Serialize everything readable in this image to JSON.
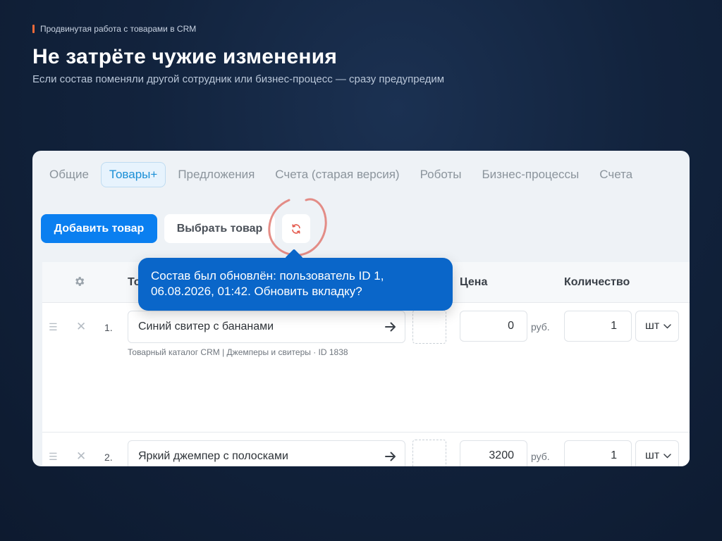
{
  "header": {
    "eyebrow": "Продвинутая работа с товарами в CRM",
    "title": "Не затрёте чужие изменения",
    "subtitle": "Если состав поменяли другой сотрудник или бизнес-процесс — сразу предупредим"
  },
  "tabs": [
    {
      "label": "Общие",
      "active": false
    },
    {
      "label": "Товары+",
      "active": true
    },
    {
      "label": "Предложения",
      "active": false
    },
    {
      "label": "Счета (старая версия)",
      "active": false
    },
    {
      "label": "Роботы",
      "active": false
    },
    {
      "label": "Бизнес-процессы",
      "active": false
    },
    {
      "label": "Счета",
      "active": false
    }
  ],
  "toolbar": {
    "add_label": "Добавить товар",
    "select_label": "Выбрать товар",
    "refresh_icon": "refresh-icon"
  },
  "table": {
    "columns": {
      "product": "То",
      "price": "Цена",
      "quantity": "Количество"
    },
    "rows": [
      {
        "num": "1.",
        "product": "Синий свитер с бананами",
        "meta": "Товарный каталог CRM | Джемперы и свитеры · ID 1838",
        "price": "0",
        "currency": "руб.",
        "quantity": "1",
        "unit": "шт"
      },
      {
        "num": "2.",
        "product": "Яркий джемпер с полосками",
        "price": "3200",
        "currency": "руб.",
        "quantity": "1",
        "unit": "шт"
      }
    ]
  },
  "tooltip": {
    "text": "Состав был обновлён: пользователь ID 1, 06.08.2026, 01:42. Обновить вкладку?"
  },
  "colors": {
    "accent": "#0a7ff0",
    "tooltip": "#0a66c9",
    "highlight_circle": "#e07a72",
    "eyebrow_bar": "#ef6a3a"
  }
}
